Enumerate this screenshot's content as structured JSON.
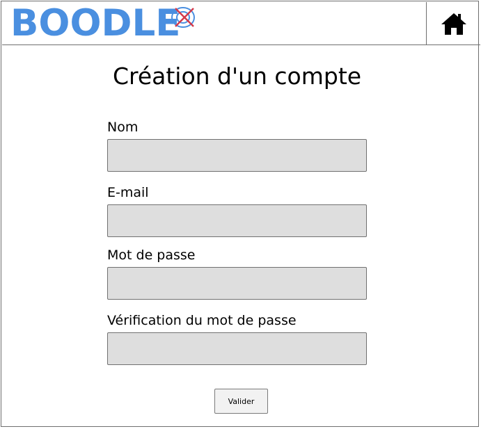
{
  "header": {
    "logo_text": "BOODLE",
    "logo_color": "#4a8fe0",
    "logo_mark_ring_color": "#4a8fe0",
    "logo_mark_cross_color": "#d43a4a",
    "home_icon": "home-icon"
  },
  "main": {
    "title": "Création d'un compte",
    "fields": [
      {
        "label": "Nom",
        "value": ""
      },
      {
        "label": "E-mail",
        "value": ""
      },
      {
        "label": "Mot de passe",
        "value": ""
      },
      {
        "label": "Vérification du mot de passe",
        "value": ""
      }
    ],
    "submit_label": "Valider"
  }
}
